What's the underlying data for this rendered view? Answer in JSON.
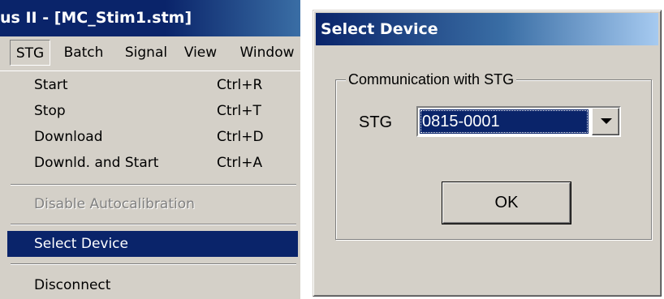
{
  "window": {
    "title": "us II - [MC_Stim1.stm]"
  },
  "menubar": {
    "items": [
      {
        "label": "STG"
      },
      {
        "label": "Batch"
      },
      {
        "label": "Signal"
      },
      {
        "label": "View"
      },
      {
        "label": "Window"
      }
    ]
  },
  "menu": {
    "items": [
      {
        "label": "Start",
        "shortcut": "Ctrl+R"
      },
      {
        "label": "Stop",
        "shortcut": "Ctrl+T"
      },
      {
        "label": "Download",
        "shortcut": "Ctrl+D"
      },
      {
        "label": "Downld. and Start",
        "shortcut": "Ctrl+A"
      },
      {
        "label": "Disable Autocalibration",
        "shortcut": ""
      },
      {
        "label": "Select Device",
        "shortcut": ""
      },
      {
        "label": "Disconnect",
        "shortcut": ""
      }
    ]
  },
  "dialog": {
    "title": "Select Device",
    "group_label": "Communication with STG",
    "stg_label": "STG",
    "selected_device": "0815-0001",
    "ok_label": "OK"
  },
  "colors": {
    "title_bar": "#0a246a",
    "selection": "#0a246a",
    "face": "#d4d0c8"
  }
}
